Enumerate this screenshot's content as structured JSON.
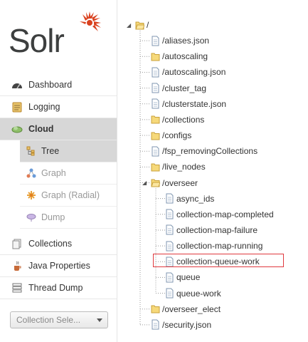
{
  "app": {
    "logo_text": "Solr"
  },
  "sidebar": {
    "items": [
      {
        "label": "Dashboard",
        "icon": "dashboard-icon"
      },
      {
        "label": "Logging",
        "icon": "logging-icon"
      },
      {
        "label": "Cloud",
        "icon": "cloud-icon",
        "active": true
      }
    ],
    "cloud_sub": [
      {
        "label": "Tree",
        "icon": "tree-icon",
        "active": true
      },
      {
        "label": "Graph",
        "icon": "graph-icon"
      },
      {
        "label": "Graph (Radial)",
        "icon": "graph-radial-icon"
      },
      {
        "label": "Dump",
        "icon": "dump-icon"
      }
    ],
    "bottom_items": [
      {
        "label": "Collections",
        "icon": "collections-icon"
      },
      {
        "label": "Java Properties",
        "icon": "java-icon"
      },
      {
        "label": "Thread Dump",
        "icon": "thread-dump-icon"
      }
    ],
    "collection_selector": {
      "placeholder": "Collection Sele..."
    }
  },
  "tree": {
    "root": {
      "label": "/",
      "type": "folder"
    },
    "nodes": [
      {
        "label": "/aliases.json",
        "type": "file"
      },
      {
        "label": "/autoscaling",
        "type": "folder"
      },
      {
        "label": "/autoscaling.json",
        "type": "file"
      },
      {
        "label": "/cluster_tag",
        "type": "file"
      },
      {
        "label": "/clusterstate.json",
        "type": "file"
      },
      {
        "label": "/collections",
        "type": "folder"
      },
      {
        "label": "/configs",
        "type": "folder"
      },
      {
        "label": "/fsp_removingCollections",
        "type": "file"
      },
      {
        "label": "/live_nodes",
        "type": "folder"
      },
      {
        "label": "/overseer",
        "type": "folder-open"
      },
      {
        "label": "async_ids",
        "type": "file",
        "child": true
      },
      {
        "label": "collection-map-completed",
        "type": "file",
        "child": true
      },
      {
        "label": "collection-map-failure",
        "type": "file",
        "child": true
      },
      {
        "label": "collection-map-running",
        "type": "file",
        "child": true
      },
      {
        "label": "collection-queue-work",
        "type": "file",
        "child": true,
        "highlighted": true
      },
      {
        "label": "queue",
        "type": "file",
        "child": true
      },
      {
        "label": "queue-work",
        "type": "file",
        "child": true
      },
      {
        "label": "/overseer_elect",
        "type": "folder"
      },
      {
        "label": "/security.json",
        "type": "file"
      }
    ]
  },
  "colors": {
    "highlight_border": "#e0393e",
    "logo_sun": "#d9411e",
    "folder": "#f6d97a"
  }
}
